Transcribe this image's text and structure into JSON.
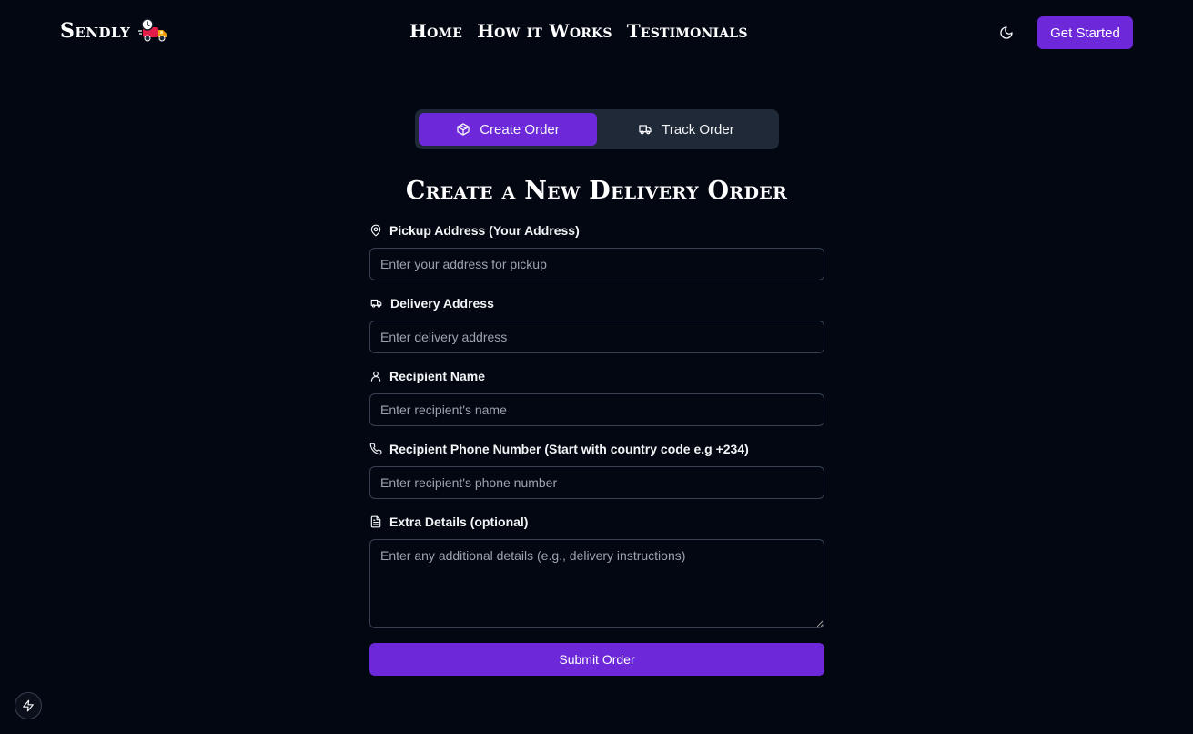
{
  "header": {
    "logo_text": "Sendly",
    "logo_icon": "delivery-truck-logo",
    "nav": [
      "Home",
      "How it Works",
      "Testimonials"
    ],
    "theme_icon": "moon-icon",
    "cta_label": "Get Started"
  },
  "tabs": [
    {
      "label": "Create Order",
      "icon": "package-icon",
      "active": true
    },
    {
      "label": "Track Order",
      "icon": "truck-icon",
      "active": false
    }
  ],
  "form": {
    "title": "Create a New Delivery Order",
    "fields": [
      {
        "label": "Pickup Address (Your Address)",
        "icon": "map-pin-icon",
        "placeholder": "Enter your address for pickup",
        "value": ""
      },
      {
        "label": "Delivery Address",
        "icon": "truck-icon",
        "placeholder": "Enter delivery address",
        "value": ""
      },
      {
        "label": "Recipient Name",
        "icon": "user-icon",
        "placeholder": "Enter recipient's name",
        "value": ""
      },
      {
        "label": "Recipient Phone Number (Start with country code e.g +234)",
        "icon": "phone-icon",
        "placeholder": "Enter recipient's phone number",
        "value": ""
      },
      {
        "label": "Extra Details (optional)",
        "icon": "file-text-icon",
        "placeholder": "Enter any additional details (e.g., delivery instructions)",
        "value": ""
      }
    ],
    "submit_label": "Submit Order"
  },
  "floating": {
    "icon": "lightning-bolt-icon"
  },
  "colors": {
    "background": "#030712",
    "accent": "#6d28d9",
    "tab_bar": "#1f2937",
    "border": "#374151"
  }
}
